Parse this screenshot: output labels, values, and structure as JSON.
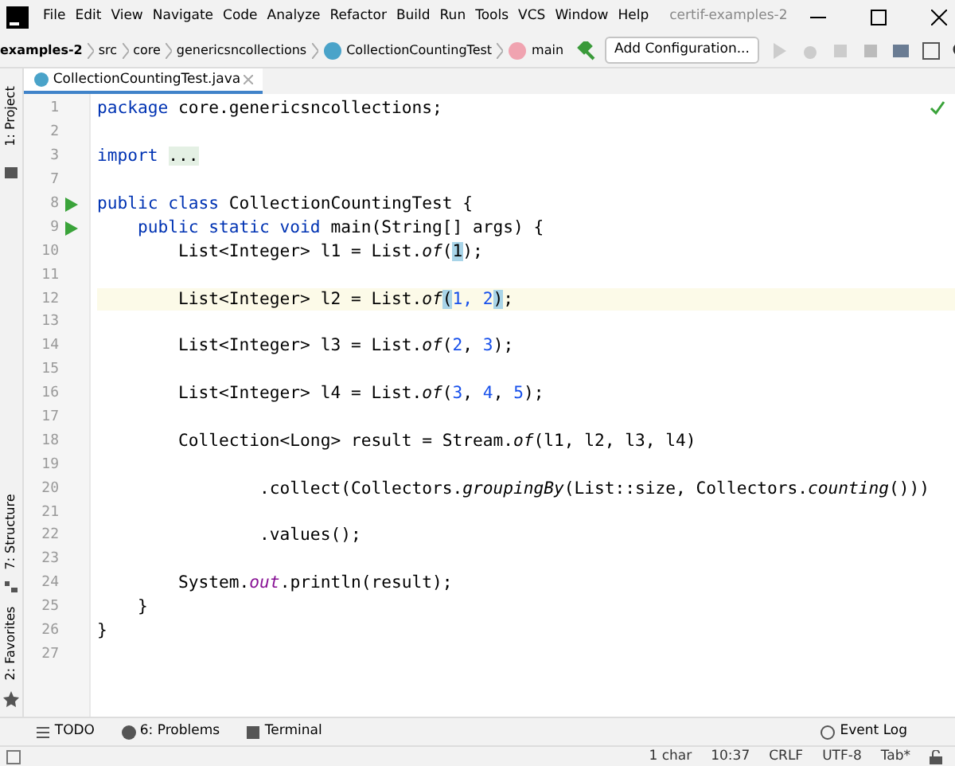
{
  "window": {
    "title": "certif-examples-2"
  },
  "menu": [
    "File",
    "Edit",
    "View",
    "Navigate",
    "Code",
    "Analyze",
    "Refactor",
    "Build",
    "Run",
    "Tools",
    "VCS",
    "Window",
    "Help"
  ],
  "breadcrumbs": [
    {
      "label": "examples-2",
      "kind": "project"
    },
    {
      "label": "src",
      "kind": "folder"
    },
    {
      "label": "core",
      "kind": "folder"
    },
    {
      "label": "genericsncollections",
      "kind": "folder"
    },
    {
      "label": "CollectionCountingTest",
      "kind": "class"
    },
    {
      "label": "main",
      "kind": "method"
    }
  ],
  "run_config": {
    "label": "Add Configuration..."
  },
  "editor_tabs": [
    {
      "label": "CollectionCountingTest.java",
      "selected": true
    }
  ],
  "side_tools": [
    {
      "label": "1: Project",
      "kind": "project"
    },
    {
      "label": "7: Structure",
      "kind": "structure"
    },
    {
      "label": "2: Favorites",
      "kind": "favorites"
    }
  ],
  "code_lines": [
    {
      "number": "1",
      "run": false,
      "current": false,
      "tokens": [
        {
          "kind": "kw",
          "t": "package"
        },
        {
          "kind": "txt",
          "t": " core.genericsncollections;"
        }
      ]
    },
    {
      "number": "2",
      "run": false,
      "current": false
    },
    {
      "number": "3",
      "run": false,
      "current": false,
      "tokens": [
        {
          "kind": "kw",
          "t": "import "
        },
        {
          "kind": "fold",
          "t": "..."
        }
      ]
    },
    {
      "number": "7",
      "run": false,
      "current": false
    },
    {
      "number": "8",
      "run": true,
      "current": false,
      "tokens": [
        {
          "kind": "kw",
          "t": "public class"
        },
        {
          "kind": "txt",
          "t": " CollectionCountingTest {"
        }
      ]
    },
    {
      "number": "9",
      "run": true,
      "current": false,
      "tokens": [
        {
          "kind": "kw",
          "t": "    public static void"
        },
        {
          "kind": "txt",
          "t": " main(String[] args) {"
        }
      ]
    },
    {
      "number": "10",
      "run": false,
      "current": false,
      "tokens": [
        {
          "kind": "txt",
          "t": "        List<Integer> l1 = List."
        },
        {
          "kind": "ital",
          "t": "of"
        },
        {
          "kind": "txt",
          "t": "("
        },
        {
          "kind": "hl",
          "t": "1"
        },
        {
          "kind": "txt",
          "t": ");"
        }
      ]
    },
    {
      "number": "11",
      "run": false,
      "current": false
    },
    {
      "number": "12",
      "run": false,
      "current": true,
      "tokens": [
        {
          "kind": "txt",
          "t": "        List<Integer> l2 = List."
        },
        {
          "kind": "ital",
          "t": "of"
        },
        {
          "kind": "hl",
          "t": "("
        },
        {
          "kind": "num",
          "t": "1, 2"
        },
        {
          "kind": "hl",
          "t": ")"
        },
        {
          "kind": "txt",
          "t": ";"
        }
      ]
    },
    {
      "number": "13",
      "run": false,
      "current": false
    },
    {
      "number": "14",
      "run": false,
      "current": false,
      "tokens": [
        {
          "kind": "txt",
          "t": "        List<Integer> l3 = List."
        },
        {
          "kind": "ital",
          "t": "of"
        },
        {
          "kind": "txt",
          "t": "("
        },
        {
          "kind": "num",
          "t": "2"
        },
        {
          "kind": "txt",
          "t": ", "
        },
        {
          "kind": "num",
          "t": "3"
        },
        {
          "kind": "txt",
          "t": ");"
        }
      ]
    },
    {
      "number": "15",
      "run": false,
      "current": false
    },
    {
      "number": "16",
      "run": false,
      "current": false,
      "tokens": [
        {
          "kind": "txt",
          "t": "        List<Integer> l4 = List."
        },
        {
          "kind": "ital",
          "t": "of"
        },
        {
          "kind": "txt",
          "t": "("
        },
        {
          "kind": "num",
          "t": "3"
        },
        {
          "kind": "txt",
          "t": ", "
        },
        {
          "kind": "num",
          "t": "4"
        },
        {
          "kind": "txt",
          "t": ", "
        },
        {
          "kind": "num",
          "t": "5"
        },
        {
          "kind": "txt",
          "t": ");"
        }
      ]
    },
    {
      "number": "17",
      "run": false,
      "current": false
    },
    {
      "number": "18",
      "run": false,
      "current": false,
      "tokens": [
        {
          "kind": "txt",
          "t": "        Collection<Long> result = Stream."
        },
        {
          "kind": "ital",
          "t": "of"
        },
        {
          "kind": "txt",
          "t": "(l1, l2, l3, l4)"
        }
      ]
    },
    {
      "number": "19",
      "run": false,
      "current": false
    },
    {
      "number": "20",
      "run": false,
      "current": false,
      "tokens": [
        {
          "kind": "txt",
          "t": "                .collect(Collectors."
        },
        {
          "kind": "ital",
          "t": "groupingBy"
        },
        {
          "kind": "txt",
          "t": "(List::size, Collectors."
        },
        {
          "kind": "ital",
          "t": "counting"
        },
        {
          "kind": "txt",
          "t": "()))"
        }
      ]
    },
    {
      "number": "21",
      "run": false,
      "current": false
    },
    {
      "number": "22",
      "run": false,
      "current": false,
      "tokens": [
        {
          "kind": "txt",
          "t": "                .values();"
        }
      ]
    },
    {
      "number": "23",
      "run": false,
      "current": false
    },
    {
      "number": "24",
      "run": false,
      "current": false,
      "tokens": [
        {
          "kind": "txt",
          "t": "        System."
        },
        {
          "kind": "field",
          "t": "out"
        },
        {
          "kind": "txt",
          "t": ".println(result);"
        }
      ]
    },
    {
      "number": "25",
      "run": false,
      "current": false,
      "tokens": [
        {
          "kind": "txt",
          "t": "    }"
        }
      ]
    },
    {
      "number": "26",
      "run": false,
      "current": false,
      "tokens": [
        {
          "kind": "txt",
          "t": "}"
        }
      ]
    },
    {
      "number": "27",
      "run": false,
      "current": false
    }
  ],
  "bottom_tools": [
    {
      "label": "TODO",
      "kind": "todo"
    },
    {
      "label": "6: Problems",
      "kind": "problems"
    },
    {
      "label": "Terminal",
      "kind": "terminal"
    },
    {
      "label": "Event Log",
      "kind": "eventlog"
    }
  ],
  "status_bar": [
    "1 char",
    "10:37",
    "CRLF",
    "UTF-8",
    "Tab*"
  ]
}
